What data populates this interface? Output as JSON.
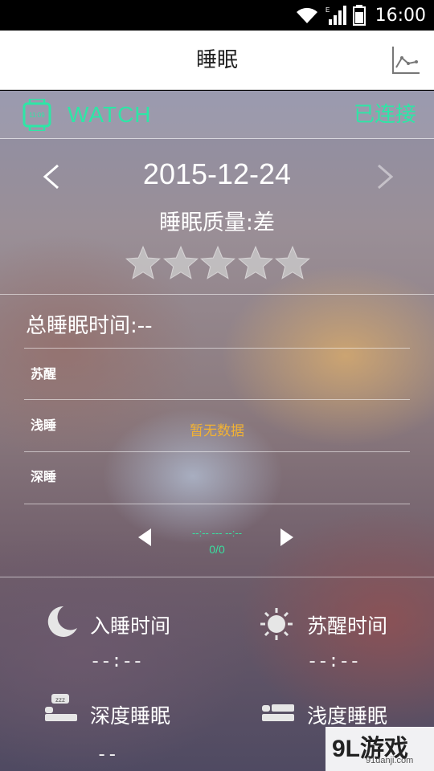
{
  "status_bar": {
    "time": "16:00"
  },
  "header": {
    "title": "睡眠"
  },
  "device": {
    "name": "WATCH",
    "status": "已连接",
    "accent": "#2ee6a6"
  },
  "date_nav": {
    "date": "2015-12-24"
  },
  "quality": {
    "label": "睡眠质量:差",
    "stars_total": 5,
    "stars_filled": 0
  },
  "total_sleep": {
    "label": "总睡眠时间:--"
  },
  "stages": [
    {
      "label": "苏醒"
    },
    {
      "label": "浅睡"
    },
    {
      "label": "深睡"
    }
  ],
  "chart": {
    "empty_text": "暂无数据",
    "empty_color": "#f2b233"
  },
  "pager": {
    "range": "--:-- --- --:--",
    "count": "0/0"
  },
  "summary": [
    {
      "icon": "moon-icon",
      "label": "入睡时间",
      "value": "--:--"
    },
    {
      "icon": "sun-icon",
      "label": "苏醒时间",
      "value": "--:--"
    },
    {
      "icon": "deep-sleep-icon",
      "label": "深度睡眠",
      "value": "--"
    },
    {
      "icon": "light-sleep-icon",
      "label": "浅度睡眠",
      "value": ""
    }
  ],
  "watermark": {
    "logo": "9L游戏",
    "site": "91danji.com"
  }
}
